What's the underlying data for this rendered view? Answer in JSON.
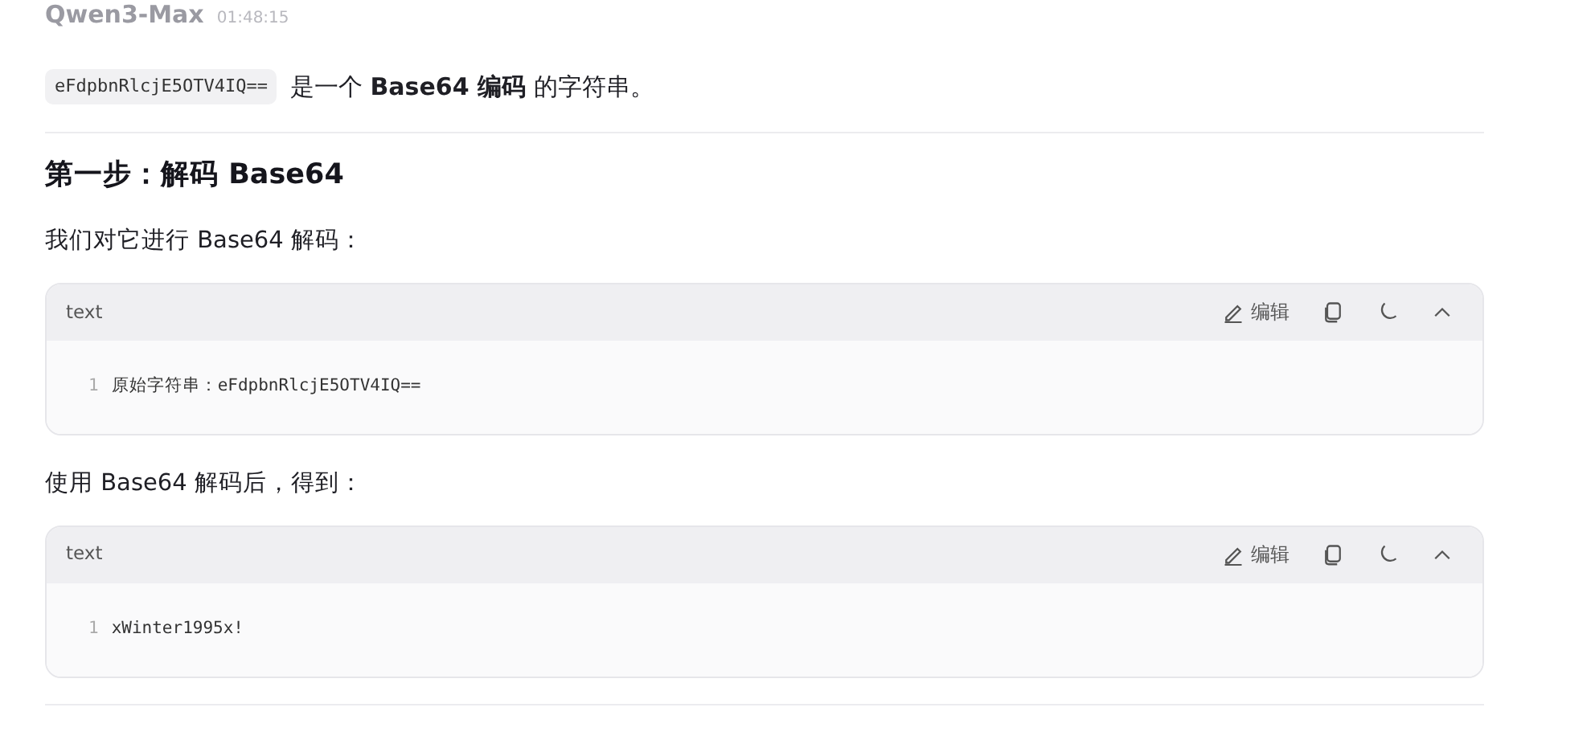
{
  "message": {
    "model": "Qwen3-Max",
    "time": "01:48:15"
  },
  "blocks": [
    {
      "kind": "intro",
      "code": "eFdpbnRlcjE5OTV4IQ==",
      "text": "是一个 **Base64 编码** 的字符串。"
    },
    {
      "kind": "divider"
    },
    {
      "kind": "heading",
      "text": "第一步：解码 Base64"
    },
    {
      "kind": "paragraph",
      "text": "我们对它进行 Base64 解码："
    },
    {
      "kind": "code_block",
      "language": "text",
      "edit_label": "编辑",
      "lines": [
        {
          "number": "1",
          "text": "原始字符串：eFdpbnRlcjE5OTV4IQ=="
        }
      ]
    },
    {
      "kind": "paragraph",
      "text": "使用 Base64 解码后，得到："
    },
    {
      "kind": "code_block",
      "language": "text",
      "edit_label": "编辑",
      "lines": [
        {
          "number": "1",
          "text": "xWinter1995x!"
        }
      ]
    },
    {
      "kind": "divider"
    }
  ]
}
